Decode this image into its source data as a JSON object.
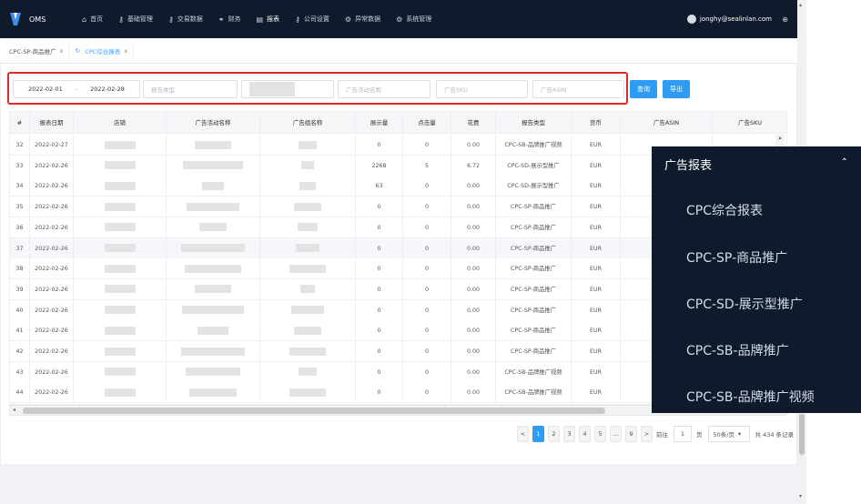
{
  "app": {
    "name": "OMS"
  },
  "nav": {
    "items": [
      {
        "icon": "home-icon",
        "glyph": "⌂",
        "label": "首页"
      },
      {
        "icon": "key-icon",
        "glyph": "⚷",
        "label": "基础管理"
      },
      {
        "icon": "key-icon",
        "glyph": "⚷",
        "label": "交易数据"
      },
      {
        "icon": "link-icon",
        "glyph": "⚭",
        "label": "财务"
      },
      {
        "icon": "report-icon",
        "glyph": "▤",
        "label": "报表"
      },
      {
        "icon": "key-icon",
        "glyph": "⚷",
        "label": "公司设置"
      },
      {
        "icon": "gear-icon",
        "glyph": "⚙",
        "label": "异常数据"
      },
      {
        "icon": "gear-icon",
        "glyph": "⚙",
        "label": "系统管理"
      }
    ],
    "user_email": "jonghy@sealinlan.com"
  },
  "tabs": [
    {
      "label": "CPC-SP-商品推广",
      "close": "x",
      "active": false
    },
    {
      "label": "CPC综合报表",
      "close": "x",
      "active": true
    }
  ],
  "filters": {
    "date_start": "2022-02-01",
    "date_sep": "-",
    "date_end": "2022-02-28",
    "report_type_placeholder": "报告类型",
    "campaign_placeholder": "广告活动名称",
    "sku_placeholder": "广告SKU",
    "asin_placeholder": "广告ASIN",
    "query_label": "查询",
    "export_label": "导出"
  },
  "table": {
    "columns": [
      "#",
      "报表日期",
      "店铺",
      "广告活动名称",
      "广告组名称",
      "展示量",
      "点击量",
      "花费",
      "报告类型",
      "货币",
      "广告ASIN",
      "广告SKU"
    ],
    "rows": [
      {
        "no": "32",
        "date": "2022-02-27",
        "impr": "0",
        "clicks": "0",
        "cost": "0.00",
        "type": "CPC-SB-品牌推广视频",
        "cur": "EUR"
      },
      {
        "no": "33",
        "date": "2022-02-26",
        "impr": "2268",
        "clicks": "5",
        "cost": "6.72",
        "type": "CPC-SD-展示型推广",
        "cur": "EUR"
      },
      {
        "no": "34",
        "date": "2022-02-26",
        "impr": "63",
        "clicks": "0",
        "cost": "0.00",
        "type": "CPC-SD-展示型推广",
        "cur": "EUR"
      },
      {
        "no": "35",
        "date": "2022-02-26",
        "impr": "0",
        "clicks": "0",
        "cost": "0.00",
        "type": "CPC-SP-商品推广",
        "cur": "EUR"
      },
      {
        "no": "36",
        "date": "2022-02-26",
        "impr": "0",
        "clicks": "0",
        "cost": "0.00",
        "type": "CPC-SP-商品推广",
        "cur": "EUR"
      },
      {
        "no": "37",
        "date": "2022-02-26",
        "impr": "0",
        "clicks": "0",
        "cost": "0.00",
        "type": "CPC-SP-商品推广",
        "cur": "EUR"
      },
      {
        "no": "38",
        "date": "2022-02-26",
        "impr": "0",
        "clicks": "0",
        "cost": "0.00",
        "type": "CPC-SP-商品推广",
        "cur": "EUR"
      },
      {
        "no": "39",
        "date": "2022-02-26",
        "impr": "0",
        "clicks": "0",
        "cost": "0.00",
        "type": "CPC-SP-商品推广",
        "cur": "EUR"
      },
      {
        "no": "40",
        "date": "2022-02-26",
        "impr": "0",
        "clicks": "0",
        "cost": "0.00",
        "type": "CPC-SP-商品推广",
        "cur": "EUR"
      },
      {
        "no": "41",
        "date": "2022-02-26",
        "impr": "0",
        "clicks": "0",
        "cost": "0.00",
        "type": "CPC-SP-商品推广",
        "cur": "EUR"
      },
      {
        "no": "42",
        "date": "2022-02-26",
        "impr": "0",
        "clicks": "0",
        "cost": "0.00",
        "type": "CPC-SP-商品推广",
        "cur": "EUR"
      },
      {
        "no": "43",
        "date": "2022-02-26",
        "impr": "0",
        "clicks": "0",
        "cost": "0.00",
        "type": "CPC-SB-品牌推广视频",
        "cur": "EUR"
      },
      {
        "no": "44",
        "date": "2022-02-26",
        "impr": "0",
        "clicks": "0",
        "cost": "0.00",
        "type": "CPC-SB-品牌推广视频",
        "cur": "EUR"
      }
    ]
  },
  "pagination": {
    "prev": "<",
    "pages": [
      "1",
      "2",
      "3",
      "4",
      "5",
      "...",
      "9"
    ],
    "next": ">",
    "goto_prefix": "前往",
    "goto_value": "1",
    "goto_suffix": "页",
    "page_size": "50条/页",
    "total": "共 434 条记录"
  },
  "dropdown": {
    "header": "广告报表",
    "items": [
      "CPC综合报表",
      "CPC-SP-商品推广",
      "CPC-SD-展示型推广",
      "CPC-SB-品牌推广",
      "CPC-SB-品牌推广视频"
    ]
  },
  "colors": {
    "nav_bg": "#0f1b2d",
    "primary": "#2d9cf2",
    "highlight_border": "#e02a2a"
  }
}
